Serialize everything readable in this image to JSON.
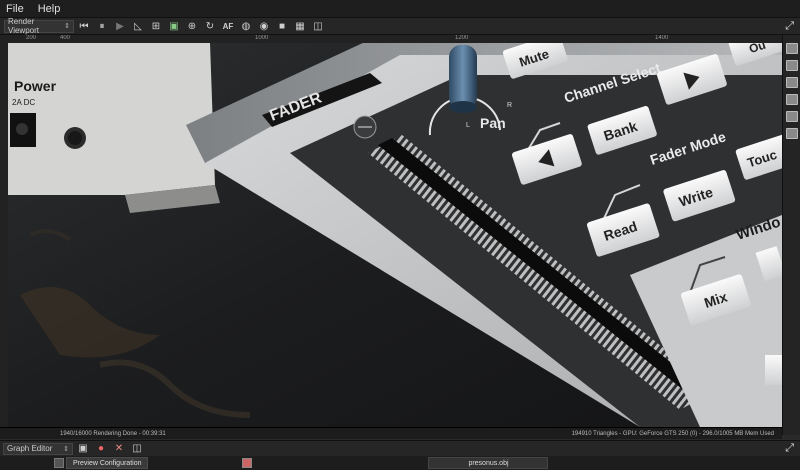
{
  "menu": {
    "file": "File",
    "help": "Help"
  },
  "viewport_toolbar": {
    "viewport_select": "Render Viewport",
    "af_label": "AF"
  },
  "scene": {
    "power_label": "Power",
    "dc_label": "2A DC",
    "fader_label": "FADER",
    "mute": "Mute",
    "channel_select": "Channel Select",
    "bank": "Bank",
    "pan": "Pan",
    "pan_l": "L",
    "pan_r": "R",
    "fader_mode": "Fader Mode",
    "write": "Write",
    "read": "Read",
    "touch": "Touc",
    "window": "Windo",
    "mix": "Mix",
    "out": "Ou"
  },
  "status": {
    "left": "1940/16000 Rendering Done - 00:39:31",
    "right": "194910 Triangles - GPU: GeForce GTS 250 (0) - 296.0/1005 MB Mem Used"
  },
  "graph_editor": {
    "select": "Graph Editor",
    "tab_preview": "Preview Configuration",
    "tab_file": "presonus.obj"
  },
  "ruler_ticks": [
    "200",
    "400",
    "1000",
    "1200",
    "1400"
  ]
}
